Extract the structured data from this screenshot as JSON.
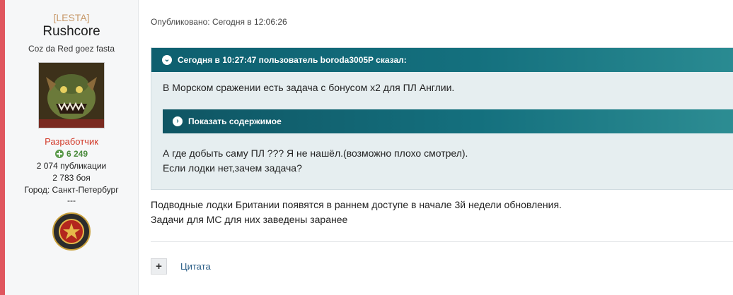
{
  "author": {
    "group_tag": "[LESTA]",
    "name": "Rushcore",
    "motto": "Coz da Red goez fasta",
    "role": "Разработчик",
    "reputation": "6 249",
    "posts": "2 074 публикации",
    "battles": "2 783 боя",
    "city": "Город: Санкт-Петербург",
    "extra": "---"
  },
  "post": {
    "published": "Опубликовано: Сегодня в 12:06:26",
    "quote": {
      "header": "Сегодня в 10:27:47 пользователь boroda3005P сказал:",
      "line1": "В Морском сражении есть задача с бонусом х2 для ПЛ Англии.",
      "spoiler_label": "Показать содержимое",
      "line2": "А где добыть саму ПЛ ??? Я не нашёл.(возможно плохо смотрел).",
      "line3": "Если лодки нет,зачем задача?"
    },
    "answer_line1": "Подводные лодки Британии появятся в раннем доступе в начале 3й недели обновления.",
    "answer_line2": "Задачи для МС для них заведены заранее",
    "add_label": "+",
    "quote_button": "Цитата"
  },
  "colors": {
    "stripe": "#e0565e",
    "quote_header": "#0e5f6f",
    "role": "#d23a2a",
    "reputation": "#4a8a3c",
    "link": "#2a5d86"
  },
  "icons": {
    "quote_toggle": "chevron-down-icon",
    "spoiler_toggle": "chevron-right-icon",
    "reputation": "plus-circle-icon",
    "badge": "star-medal-icon"
  }
}
